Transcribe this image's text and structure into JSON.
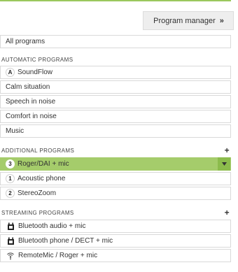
{
  "header": {
    "program_manager_label": "Program manager",
    "program_manager_chevron": "»"
  },
  "all_programs": {
    "label": "All programs"
  },
  "automatic": {
    "title": "AUTOMATIC PROGRAMS",
    "items": [
      {
        "badge": "A",
        "label": "SoundFlow"
      },
      {
        "label": "Calm situation"
      },
      {
        "label": "Speech in noise"
      },
      {
        "label": "Comfort in noise"
      },
      {
        "label": "Music"
      }
    ]
  },
  "additional": {
    "title": "ADDITIONAL PROGRAMS",
    "add_symbol": "+",
    "items": [
      {
        "badge": "3",
        "label": "Roger/DAI + mic",
        "selected": true
      },
      {
        "badge": "1",
        "label": "Acoustic phone"
      },
      {
        "badge": "2",
        "label": "StereoZoom"
      }
    ]
  },
  "streaming": {
    "title": "STREAMING PROGRAMS",
    "add_symbol": "+",
    "items": [
      {
        "icon": "bluetooth-device-icon",
        "label": "Bluetooth audio + mic"
      },
      {
        "icon": "bluetooth-device-icon",
        "label": "Bluetooth phone / DECT + mic"
      },
      {
        "icon": "wireless-remote-mic-icon",
        "label": "RemoteMic / Roger + mic"
      }
    ]
  },
  "colors": {
    "accent_green": "#a5cc6b",
    "dropdown_green": "#8cbc4c",
    "top_line": "#9ac85d"
  }
}
